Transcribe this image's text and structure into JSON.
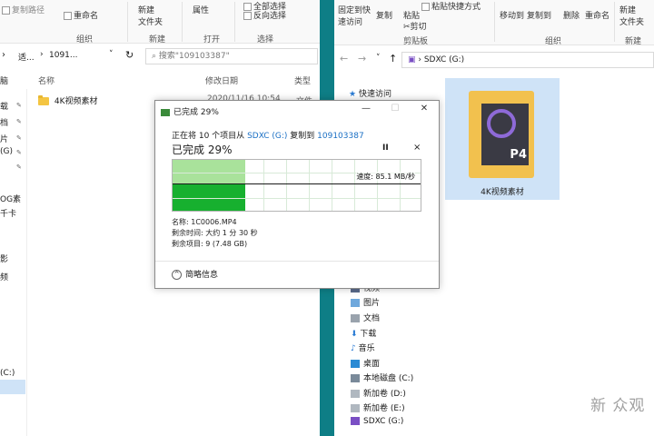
{
  "left_window": {
    "ribbon": {
      "copy_path": "复制路径",
      "rename": "重命名",
      "new_folder_line1": "新建",
      "new_folder_line2": "文件夹",
      "properties": "属性",
      "select_all": "全部选择",
      "invert_selection": "反向选择",
      "groups": [
        "组织",
        "新建",
        "打开",
        "选择"
      ]
    },
    "address": {
      "crumb1": "适...",
      "crumb2": "1091...",
      "search_placeholder": "搜索\"109103387\""
    },
    "columns": {
      "name": "名称",
      "modified": "修改日期",
      "type": "类型"
    },
    "file": {
      "name": "4K视频素材",
      "date": "2020/11/16 10:54",
      "type": "文件夹"
    },
    "nav_fragments": [
      "脑",
      "载",
      "档",
      "片",
      "(G)",
      "OG素",
      "千卡",
      "影",
      "频",
      "(C:)"
    ]
  },
  "right_window": {
    "ribbon": {
      "pin_quick_line1": "固定到快",
      "pin_quick_line2": "速访问",
      "copy": "复制",
      "paste": "粘贴",
      "paste_shortcut": "粘贴快捷方式",
      "cut": "剪切",
      "clipboard_group": "剪贴板",
      "move_to": "移动到",
      "copy_to": "复制到",
      "delete": "删除",
      "rename": "重命名",
      "organize_group": "组织",
      "new_folder_line1": "新建",
      "new_folder_line2": "文件夹",
      "new_group": "新建"
    },
    "address": {
      "drive": "SDXC (G:)"
    },
    "nav": [
      "快速访问",
      "视频",
      "图片",
      "文档",
      "下载",
      "音乐",
      "桌面",
      "本地磁盘 (C:)",
      "新加卷 (D:)",
      "新加卷 (E:)",
      "SDXC (G:)"
    ],
    "thumb": {
      "label": "4K视频素材",
      "badge": "P4"
    }
  },
  "dialog": {
    "title": "已完成 29%",
    "progress_percent": 29,
    "sub_prefix": "正在将 10 个项目从",
    "sub_source": "SDXC (G:)",
    "sub_mid": "复制到",
    "sub_dest": "109103387",
    "big_status": "已完成 29%",
    "pause": "II",
    "cancel": "×",
    "speed": "速度: 85.1 MB/秒",
    "name_line": "名称: 1C0006.MP4",
    "time_line": "剩余时间: 大约 1 分 30 秒",
    "items_line": "剩余项目: 9 (7.48 GB)",
    "details": "简略信息",
    "colors": {
      "graph_light": "#a9e29b",
      "graph_dark": "#17b02f",
      "link": "#1a6fc4"
    }
  },
  "watermark": "新 众观"
}
